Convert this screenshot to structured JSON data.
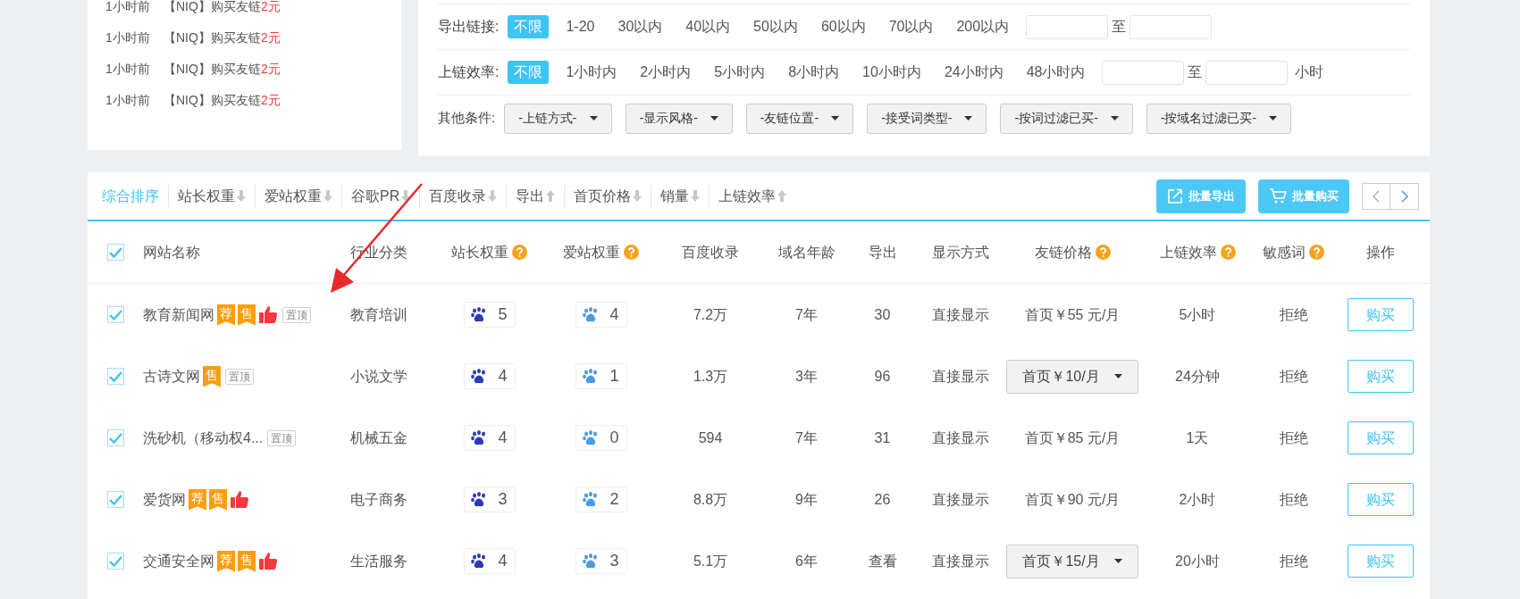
{
  "feed": [
    {
      "time": "1小时前",
      "text": "【NIQ】购买友链",
      "amount": "2元"
    },
    {
      "time": "1小时前",
      "text": "【NIQ】购买友链",
      "amount": "2元"
    },
    {
      "time": "1小时前",
      "text": "【NIQ】购买友链",
      "amount": "2元"
    },
    {
      "time": "1小时前",
      "text": "【NIQ】购买友链",
      "amount": "2元"
    }
  ],
  "filters": [
    {
      "label": "导出链接:",
      "options": [
        {
          "text": "不限",
          "selected": true
        },
        {
          "text": "1-20",
          "selected": false
        },
        {
          "text": "30以内",
          "selected": false
        },
        {
          "text": "40以内",
          "selected": false
        },
        {
          "text": "50以内",
          "selected": false
        },
        {
          "text": "60以内",
          "selected": false
        },
        {
          "text": "70以内",
          "selected": false
        },
        {
          "text": "200以内",
          "selected": false
        }
      ],
      "range_sep": "至"
    },
    {
      "label": "上链效率:",
      "options": [
        {
          "text": "不限",
          "selected": true
        },
        {
          "text": "1小时内",
          "selected": false
        },
        {
          "text": "2小时内",
          "selected": false
        },
        {
          "text": "5小时内",
          "selected": false
        },
        {
          "text": "8小时内",
          "selected": false
        },
        {
          "text": "10小时内",
          "selected": false
        },
        {
          "text": "24小时内",
          "selected": false
        },
        {
          "text": "48小时内",
          "selected": false
        }
      ],
      "range_sep": "至",
      "unit": "小时"
    }
  ],
  "other_conditions": {
    "label": "其他条件:",
    "dropdowns": [
      "-上链方式-",
      "-显示风格-",
      "-友链位置-",
      "-接受词类型-",
      "-按词过滤已买-",
      "-按域名过滤已买-"
    ]
  },
  "sort_tabs": [
    {
      "label": "综合排序",
      "selected": true
    },
    {
      "label": "站长权重",
      "selected": false,
      "ascending": false
    },
    {
      "label": "爱站权重",
      "selected": false,
      "ascending": false
    },
    {
      "label": "谷歌PR",
      "selected": false,
      "ascending": false
    },
    {
      "label": "百度收录",
      "selected": false,
      "ascending": false
    },
    {
      "label": "导出",
      "selected": false,
      "ascending": true
    },
    {
      "label": "首页价格",
      "selected": false,
      "ascending": false
    },
    {
      "label": "销量",
      "selected": false,
      "ascending": false
    },
    {
      "label": "上链效率",
      "selected": false,
      "ascending": true
    }
  ],
  "toolbar_buttons": [
    {
      "kind": "export",
      "label": "批量导出"
    },
    {
      "kind": "cart",
      "label": "批量购买"
    }
  ],
  "table": {
    "select_all": true,
    "columns": [
      {
        "label": "网站名称"
      },
      {
        "label": "行业分类"
      },
      {
        "label": "站长权重",
        "help": true
      },
      {
        "label": "爱站权重",
        "help": true
      },
      {
        "label": "百度收录"
      },
      {
        "label": "域名年龄"
      },
      {
        "label": "导出"
      },
      {
        "label": "显示方式"
      },
      {
        "label": "友链价格",
        "help": true
      },
      {
        "label": "上链效率",
        "help": true
      },
      {
        "label": "敏感词",
        "help": true
      },
      {
        "label": "操作"
      }
    ],
    "rows": [
      {
        "checked": true,
        "name": "教育新闻网",
        "tags": [
          {
            "kind": "ribbon",
            "text": "荐"
          },
          {
            "kind": "ribbon",
            "text": "售"
          },
          {
            "kind": "thumb"
          },
          {
            "kind": "outline",
            "text": "置顶"
          }
        ],
        "industry": "教育培训",
        "zz_weight": "5",
        "az_weight": "4",
        "baidu": "7.2万",
        "age": "7年",
        "export": "30",
        "display": "直接显示",
        "price": {
          "kind": "text",
          "text": "首页￥55 元/月"
        },
        "efficiency": "5小时",
        "sensitive": "拒绝",
        "action": "购买"
      },
      {
        "checked": true,
        "name": "古诗文网",
        "tags": [
          {
            "kind": "ribbon",
            "text": "售"
          },
          {
            "kind": "outline",
            "text": "置顶"
          }
        ],
        "industry": "小说文学",
        "zz_weight": "4",
        "az_weight": "1",
        "baidu": "1.3万",
        "age": "3年",
        "export": "96",
        "display": "直接显示",
        "price": {
          "kind": "dropdown",
          "text": "首页￥10/月"
        },
        "efficiency": "24分钟",
        "sensitive": "拒绝",
        "action": "购买"
      },
      {
        "checked": true,
        "name": "洗砂机（移动权4...",
        "tags": [
          {
            "kind": "outline",
            "text": "置顶"
          }
        ],
        "industry": "机械五金",
        "zz_weight": "4",
        "az_weight": "0",
        "baidu": "594",
        "age": "7年",
        "export": "31",
        "display": "直接显示",
        "price": {
          "kind": "text",
          "text": "首页￥85 元/月"
        },
        "efficiency": "1天",
        "sensitive": "拒绝",
        "action": "购买"
      },
      {
        "checked": true,
        "name": "爱货网",
        "tags": [
          {
            "kind": "ribbon",
            "text": "荐"
          },
          {
            "kind": "ribbon",
            "text": "售"
          },
          {
            "kind": "thumb"
          }
        ],
        "industry": "电子商务",
        "zz_weight": "3",
        "az_weight": "2",
        "baidu": "8.8万",
        "age": "9年",
        "export": "26",
        "display": "直接显示",
        "price": {
          "kind": "text",
          "text": "首页￥90 元/月"
        },
        "efficiency": "2小时",
        "sensitive": "拒绝",
        "action": "购买"
      },
      {
        "checked": true,
        "name": "交通安全网",
        "tags": [
          {
            "kind": "ribbon",
            "text": "荐"
          },
          {
            "kind": "ribbon",
            "text": "售"
          },
          {
            "kind": "thumb"
          }
        ],
        "industry": "生活服务",
        "zz_weight": "4",
        "az_weight": "3",
        "baidu": "5.1万",
        "age": "6年",
        "export": "查看",
        "display": "直接显示",
        "price": {
          "kind": "dropdown",
          "text": "首页￥15/月"
        },
        "efficiency": "20小时",
        "sensitive": "拒绝",
        "action": "购买"
      }
    ]
  }
}
